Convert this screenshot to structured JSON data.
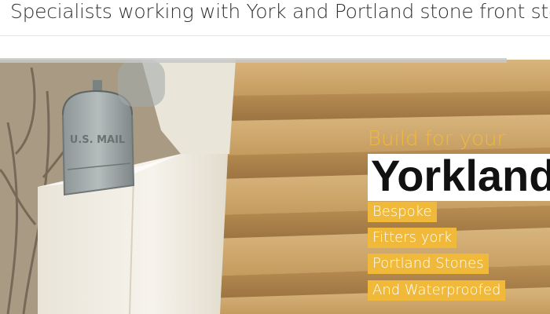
{
  "header": {
    "headline": "Specialists working with York and Portland stone front steps"
  },
  "hero": {
    "lead": "Build for your",
    "brand": "Yorkland",
    "tags": [
      "Bespoke",
      "Fitters york",
      "Portland Stones",
      "And Waterproofed"
    ],
    "mailbox_text": "U.S. MAIL"
  },
  "colors": {
    "accent": "#f0b93a",
    "stone": "#c9a36a",
    "wall": "#f1eee6"
  },
  "icons": {
    "mailbox": "mailbox-icon"
  }
}
